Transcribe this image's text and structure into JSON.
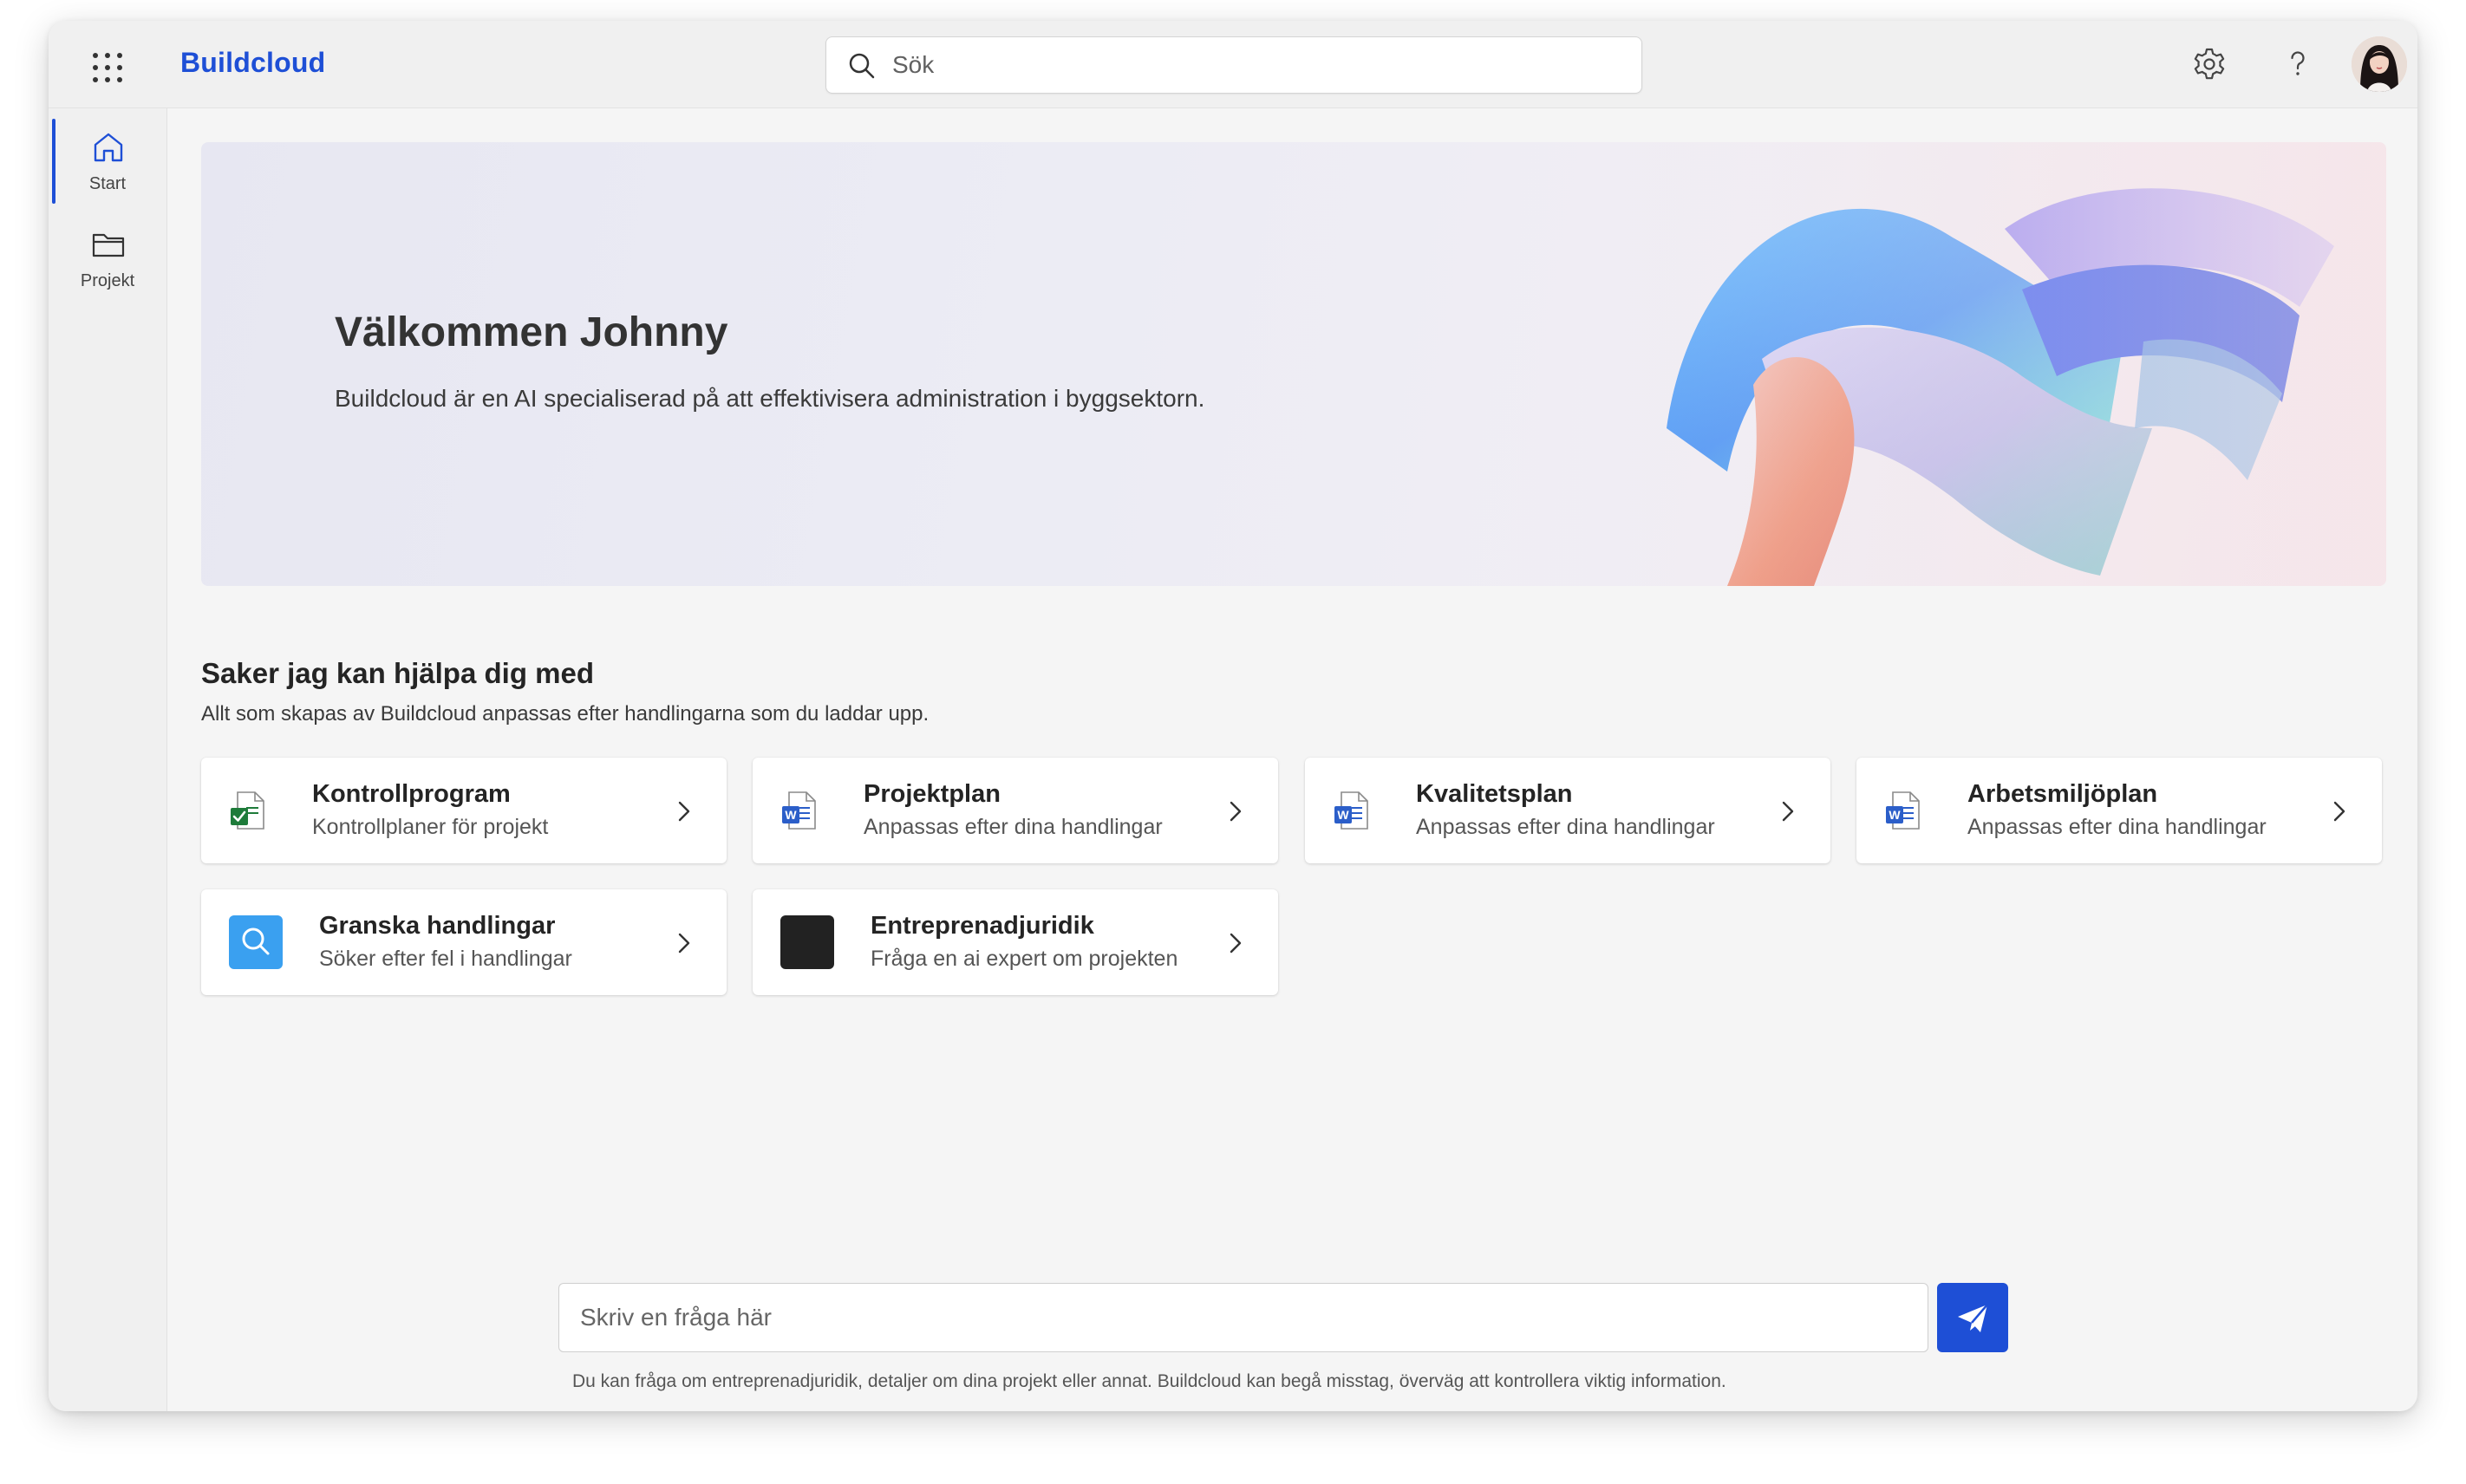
{
  "app": {
    "title": "Buildcloud"
  },
  "search": {
    "placeholder": "Sök"
  },
  "sidebar": {
    "items": [
      {
        "label": "Start",
        "icon": "home-icon",
        "active": true
      },
      {
        "label": "Projekt",
        "icon": "folder-icon",
        "active": false
      }
    ]
  },
  "hero": {
    "title": "Välkommen Johnny",
    "subtitle": "Buildcloud är en AI specialiserad på att effektivisera administration i byggsektorn."
  },
  "section": {
    "title": "Saker jag kan hjälpa dig med",
    "subtitle": "Allt som skapas av Buildcloud anpassas efter handlingarna som du laddar upp."
  },
  "cards": [
    {
      "title": "Kontrollprogram",
      "subtitle": "Kontrollplaner för projekt",
      "icon": "checklist-document-icon"
    },
    {
      "title": "Projektplan",
      "subtitle": "Anpassas efter dina handlingar",
      "icon": "word-document-icon"
    },
    {
      "title": "Kvalitetsplan",
      "subtitle": "Anpassas efter dina handlingar",
      "icon": "word-document-icon"
    },
    {
      "title": "Arbetsmiljöplan",
      "subtitle": "Anpassas efter dina handlingar",
      "icon": "word-document-icon"
    },
    {
      "title": "Granska handlingar",
      "subtitle": "Söker efter fel i handlingar",
      "icon": "review-search-icon"
    },
    {
      "title": "Entreprenadjuridik",
      "subtitle": "Fråga en ai expert om projekten",
      "icon": "legal-expert-icon"
    }
  ],
  "chat": {
    "placeholder": "Skriv en fråga här",
    "disclaimer": "Du kan fråga om entreprenadjuridik, detaljer om dina projekt eller annat. Buildcloud kan begå misstag, överväg att kontrollera viktig information."
  },
  "colors": {
    "accent": "#1e4fd6",
    "excel_green": "#1e7b3a",
    "word_blue": "#2b5ec9",
    "review_blue": "#3aa0f0"
  }
}
